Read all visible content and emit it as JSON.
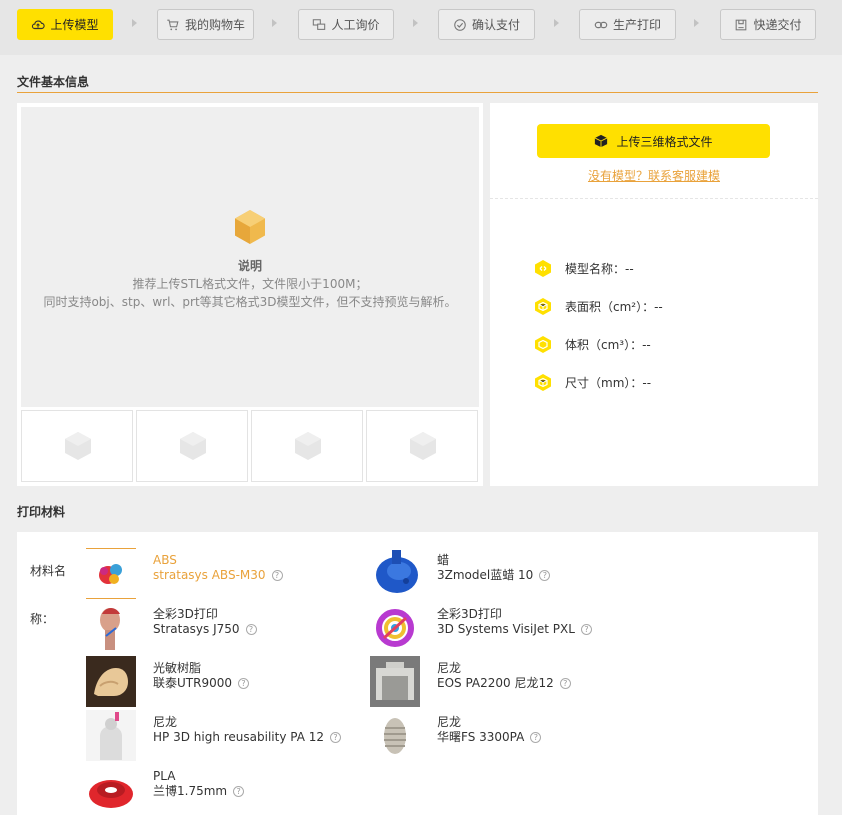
{
  "steps": [
    {
      "label": "上传模型",
      "icon": "cloud-upload-icon",
      "active": true
    },
    {
      "label": "我的购物车",
      "icon": "cart-icon",
      "active": false
    },
    {
      "label": "人工询价",
      "icon": "chat-icon",
      "active": false
    },
    {
      "label": "确认支付",
      "icon": "check-circle-icon",
      "active": false
    },
    {
      "label": "生产打印",
      "icon": "link-icon",
      "active": false
    },
    {
      "label": "快递交付",
      "icon": "package-icon",
      "active": false
    }
  ],
  "file_info": {
    "title": "文件基本信息",
    "note_title": "说明",
    "note_lines": [
      "推荐上传STL格式文件，文件限小于100M；",
      "同时支持obj、stp、wrl、prt等其它格式3D模型文件，但不支持预览与解析。"
    ],
    "upload_button": "上传三维格式文件",
    "contact_link": "没有模型？联系客服建模",
    "attributes": [
      {
        "label": "模型名称：--",
        "icon": "model-name-icon"
      },
      {
        "label": "表面积（cm²）：--",
        "icon": "surface-area-icon"
      },
      {
        "label": "体积（cm³）：--",
        "icon": "volume-icon"
      },
      {
        "label": "尺寸（mm）：--",
        "icon": "size-icon"
      }
    ]
  },
  "materials": {
    "title": "打印材料",
    "label_line1": "材料名",
    "label_line2": "称：",
    "help_glyph": "?",
    "items": [
      {
        "type": "ABS",
        "name": "stratasys ABS-M30",
        "selected": true
      },
      {
        "type": "蜡",
        "name": "3Zmodel蓝蜡 10",
        "selected": false
      },
      {
        "type": "全彩3D打印",
        "name": "Stratasys J750",
        "selected": false
      },
      {
        "type": "全彩3D打印",
        "name": "3D Systems VisiJet PXL",
        "selected": false
      },
      {
        "type": "光敏树脂",
        "name": "联泰UTR9000",
        "selected": false
      },
      {
        "type": "尼龙",
        "name": "EOS PA2200 尼龙12",
        "selected": false
      },
      {
        "type": "尼龙",
        "name": "HP 3D high reusability PA 12",
        "selected": false
      },
      {
        "type": "尼龙",
        "name": "华曙FS 3300PA",
        "selected": false
      },
      {
        "type": "PLA",
        "name": "兰博1.75mm",
        "selected": false
      }
    ]
  },
  "colors": {
    "accent_yellow": "#ffe000",
    "accent_orange": "#e9a23b"
  }
}
